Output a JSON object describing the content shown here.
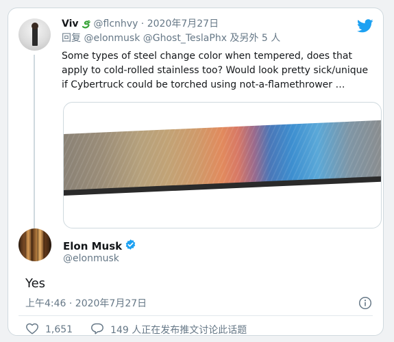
{
  "parent_tweet": {
    "display_name": "Viv",
    "name_emoji": "snake-icon",
    "handle": "@flcnhvy",
    "separator": " · ",
    "date": "2020年7月27日",
    "reply_prefix": "回复 ",
    "reply_handles": "@elonmusk @Ghost_TeslaPhx",
    "reply_suffix": " 及另外 5 人",
    "text": "Some types of steel change color when tempered, does that apply to cold-rolled stainless too? Would look pretty sick/unique if Cybertruck could be torched using not-a-flamethrower …",
    "media_icon": "tempered-steel-photo"
  },
  "main_tweet": {
    "display_name": "Elon Musk",
    "verified_icon": "verified-badge-icon",
    "handle": "@elonmusk",
    "text": "Yes",
    "timestamp": "上午4:46 · 2020年7月27日"
  },
  "actions": {
    "like_count": "1,651",
    "reply_label": "149 人正在发布推文讨论此话题"
  },
  "colors": {
    "brand": "#1da1f2",
    "text_primary": "#14171a",
    "text_secondary": "#657786",
    "border": "#cfd9de"
  }
}
